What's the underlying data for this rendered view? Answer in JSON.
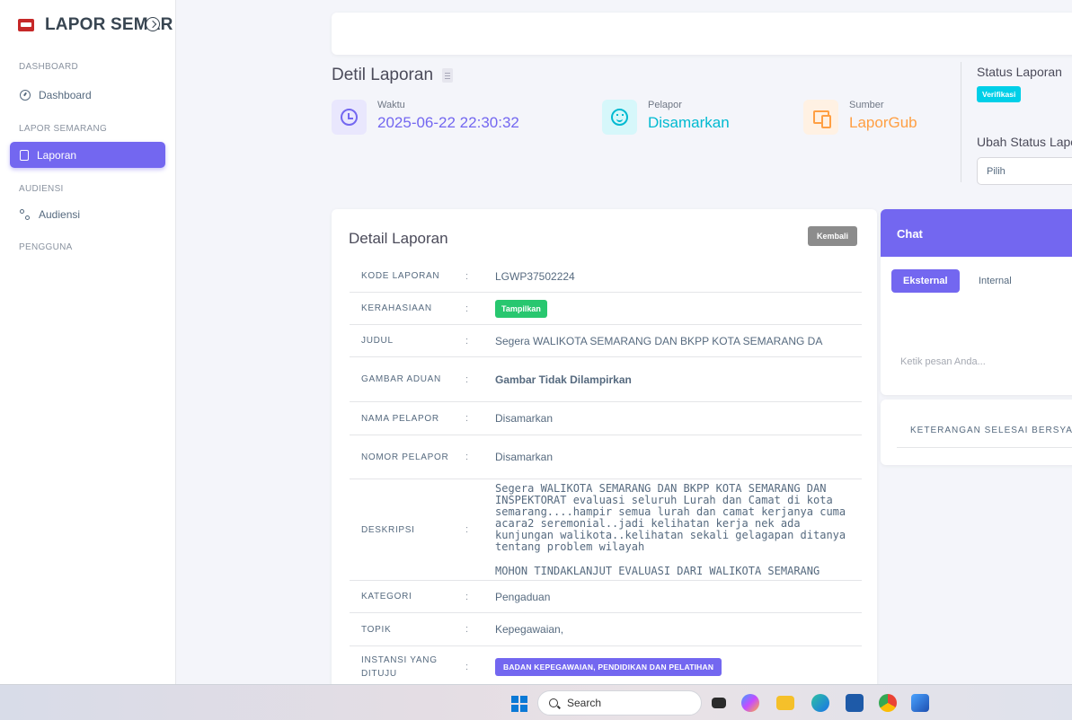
{
  "sidebar": {
    "brand": "LAPOR SEMAR",
    "sections": [
      {
        "header": "DASHBOARD",
        "items": [
          {
            "label": "Dashboard"
          }
        ]
      },
      {
        "header": "LAPOR SEMARANG",
        "items": [
          {
            "label": "Laporan"
          }
        ]
      },
      {
        "header": "AUDIENSI",
        "items": [
          {
            "label": "Audiensi"
          }
        ]
      },
      {
        "header": "PENGGUNA",
        "items": []
      }
    ]
  },
  "page": {
    "title": "Detil Laporan",
    "stats": [
      {
        "label": "Waktu",
        "value": "2025-06-22 22:30:32",
        "color": "#7367f0"
      },
      {
        "label": "Pelapor",
        "value": "Disamarkan",
        "color": "#00bad1"
      },
      {
        "label": "Sumber",
        "value": "LaporGub",
        "color": "#ff9f43"
      }
    ],
    "status": {
      "title": "Status Laporan",
      "badge": "Verifikasi",
      "change_title": "Ubah Status Lapo",
      "select_value": "Pilih"
    }
  },
  "detail": {
    "title": "Detail Laporan",
    "back_button": "Kembali",
    "rows": [
      {
        "key": "KODE LAPORAN",
        "sep": ":",
        "value": "LGWP37502224"
      },
      {
        "key": "KERAHASIAAN",
        "sep": ":",
        "value": "Tampilkan"
      },
      {
        "key": "JUDUL",
        "sep": ":",
        "value": "Segera WALIKOTA SEMARANG DAN BKPP KOTA SEMARANG DA"
      },
      {
        "key": "GAMBAR ADUAN",
        "sep": ":",
        "value": "Gambar Tidak Dilampirkan"
      },
      {
        "key": "NAMA PELAPOR",
        "sep": ":",
        "value": "Disamarkan"
      },
      {
        "key": "NOMOR PELAPOR",
        "sep": ":",
        "value": "Disamarkan"
      },
      {
        "key": "DESKRIPSI",
        "sep": ":",
        "value": "Segera WALIKOTA SEMARANG DAN BKPP KOTA SEMARANG DAN INSPEKTORAT evaluasi seluruh Lurah dan Camat di kota semarang....hampir semua lurah dan camat kerjanya cuma acara2 seremonial..jadi kelihatan kerja nek ada kunjungan walikota..kelihatan sekali gelagapan ditanya tentang problem wilayah",
        "value2": "MOHON TINDAKLANJUT EVALUASI DARI WALIKOTA SEMARANG"
      },
      {
        "key": "KATEGORI",
        "sep": ":",
        "value": "Pengaduan"
      },
      {
        "key": "TOPIK",
        "sep": ":",
        "value": "Kepegawaian,"
      },
      {
        "key": "INSTANSI YANG DITUJU",
        "sep": ":",
        "value": "BADAN KEPEGAWAIAN, PENDIDIKAN DAN PELATIHAN"
      }
    ]
  },
  "chat": {
    "title": "Chat",
    "tab_external": "Eksternal",
    "tab_internal": "Internal",
    "input_placeholder": "Ketik pesan Anda..."
  },
  "note": {
    "label": "KETERANGAN SELESAI BERSYARA"
  },
  "taskbar": {
    "search_label": "Search"
  }
}
